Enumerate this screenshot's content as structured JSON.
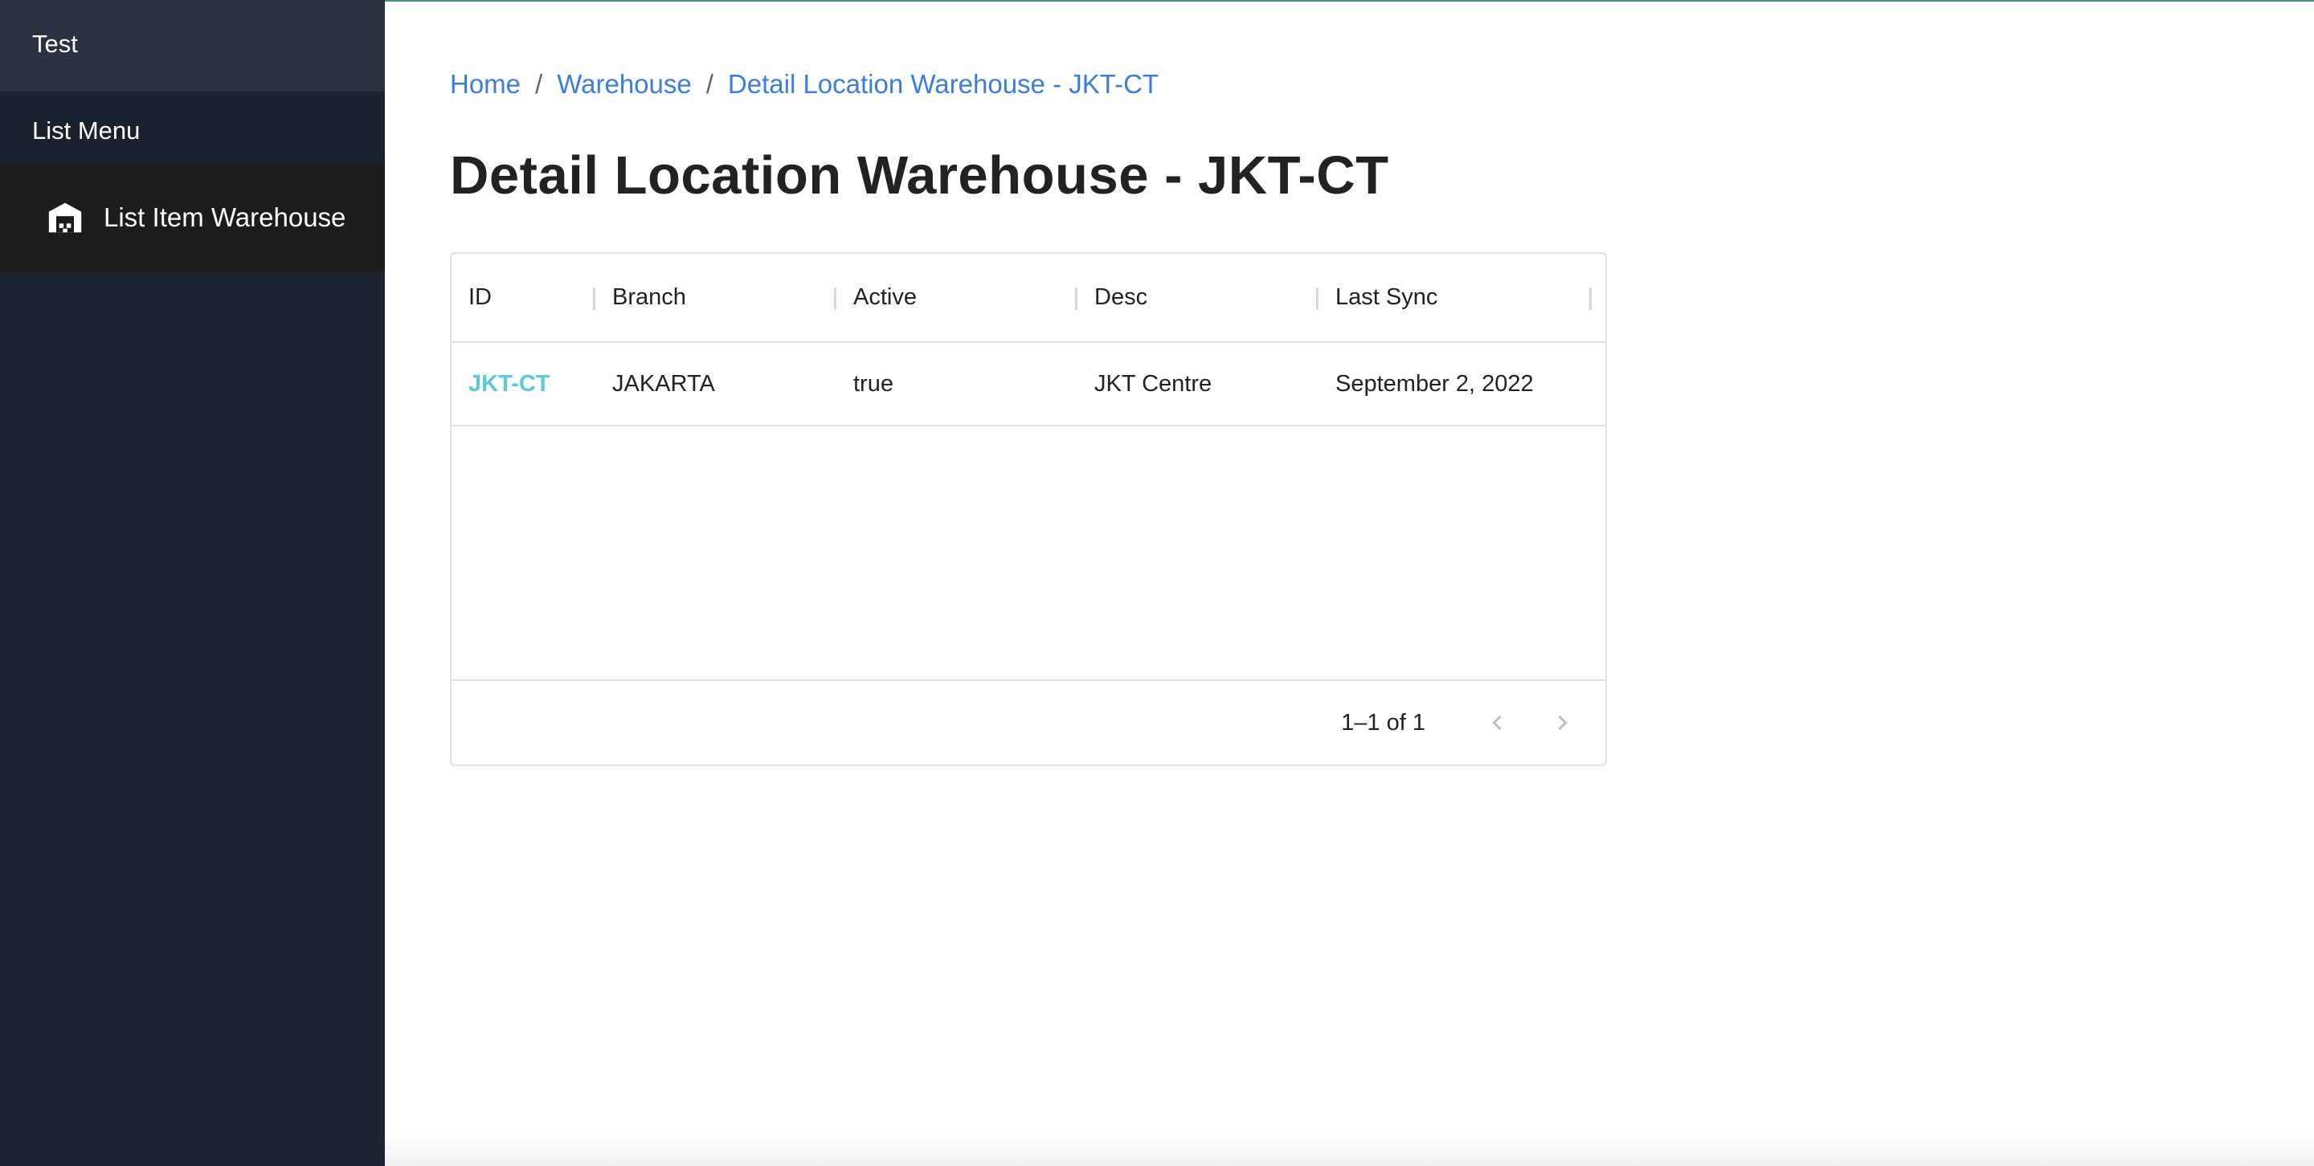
{
  "sidebar": {
    "title": "Test",
    "section_label": "List Menu",
    "items": [
      {
        "label": "List Item Warehouse",
        "icon": "warehouse-icon"
      }
    ]
  },
  "breadcrumb": {
    "items": [
      "Home",
      "Warehouse",
      "Detail Location Warehouse - JKT-CT"
    ],
    "separator": "/"
  },
  "page": {
    "title": "Detail Location Warehouse - JKT-CT"
  },
  "table": {
    "columns": [
      "ID",
      "Branch",
      "Active",
      "Desc",
      "Last Sync"
    ],
    "rows": [
      [
        "JKT-CT",
        "JAKARTA",
        "true",
        "JKT Centre",
        "September 2, 2022"
      ]
    ]
  },
  "pagination": {
    "text": "1–1 of 1",
    "prev_icon": "chevron-left-icon",
    "next_icon": "chevron-right-icon"
  },
  "colors": {
    "sidebar_bg": "#1e2430",
    "link": "#3b7ddd",
    "id_link": "#5bc8db",
    "accent_border": "#4d8f8f"
  }
}
